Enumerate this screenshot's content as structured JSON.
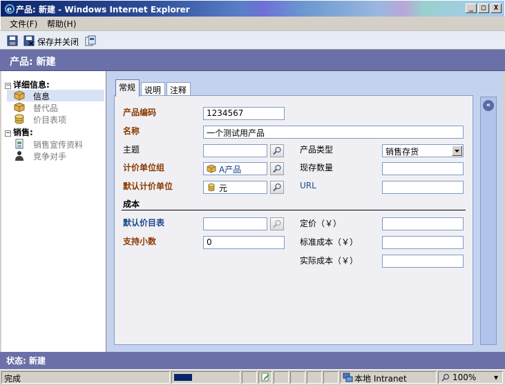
{
  "window": {
    "title": "产品: 新建 - Windows Internet Explorer",
    "min": "_",
    "max": "□",
    "close": "X"
  },
  "menu": {
    "file": "文件(F)",
    "help": "帮助(H)"
  },
  "toolbar": {
    "save_close": "保存并关闭"
  },
  "header": {
    "title": "产品: 新建"
  },
  "nav": {
    "group1": "详细信息:",
    "group1_toggle": "−",
    "items1": [
      "信息",
      "替代品",
      "价目表项"
    ],
    "group2": "销售:",
    "group2_toggle": "−",
    "items2": [
      "销售宣传资料",
      "竞争对手"
    ]
  },
  "tabs": [
    "常规",
    "说明",
    "注释"
  ],
  "form": {
    "product_code_label": "产品编码",
    "product_code_value": "1234567",
    "name_label": "名称",
    "name_value": "一个测试用产品",
    "subject_label": "主题",
    "subject_value": "",
    "product_type_label": "产品类型",
    "product_type_value": "销售存货",
    "unit_group_label": "计价单位组",
    "unit_group_value": "A产品",
    "stock_qty_label": "现存数量",
    "stock_qty_value": "",
    "default_unit_label": "默认计价单位",
    "default_unit_value": "元",
    "url_label": "URL",
    "url_value": "",
    "cost_section": "成本",
    "default_pricelist_label": "默认价目表",
    "default_pricelist_value": "",
    "list_price_label": "定价（￥）",
    "list_price_value": "",
    "decimals_label": "支持小数",
    "decimals_value": "0",
    "std_cost_label": "标准成本（￥）",
    "std_cost_value": "",
    "actual_cost_label": "实际成本（￥）",
    "actual_cost_value": ""
  },
  "status": {
    "text": "状态: 新建"
  },
  "iestatus": {
    "done": "完成",
    "zone": "本地 Intranet",
    "zoom": "100%",
    "zoom_arrow": "▾"
  },
  "collapse_glyph": "«"
}
